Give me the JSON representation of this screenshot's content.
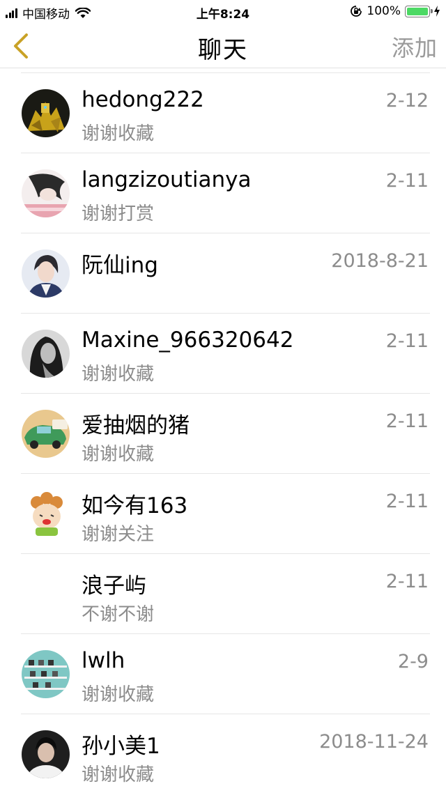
{
  "status_bar": {
    "carrier": "中国移动",
    "time": "上午8:24",
    "battery": "100%",
    "battery_level": 1.0,
    "battery_color": "#4cd964"
  },
  "nav": {
    "back_icon": "chevron-left-icon",
    "back_color": "#c9a227",
    "title": "聊天",
    "add_label": "添加"
  },
  "chats": [
    {
      "name": "hedong222",
      "message": "谢谢收藏",
      "date": "2-12",
      "avatar": "robot-avatar"
    },
    {
      "name": "langzizoutianya",
      "message": "谢谢打赏",
      "date": "2-11",
      "avatar": "girl-sketch-avatar"
    },
    {
      "name": "阮仙ing",
      "message": "",
      "date": "2018-8-21",
      "avatar": "woman-photo-avatar"
    },
    {
      "name": "Maxine_966320642",
      "message": "谢谢收藏",
      "date": "2-11",
      "avatar": "bw-portrait-avatar"
    },
    {
      "name": "爱抽烟的猪",
      "message": "谢谢收藏",
      "date": "2-11",
      "avatar": "toy-car-avatar"
    },
    {
      "name": "如今有163",
      "message": "谢谢关注",
      "date": "2-11",
      "avatar": "cartoon-avatar"
    },
    {
      "name": "浪子屿",
      "message": "不谢不谢",
      "date": "2-11",
      "avatar": "empty-avatar"
    },
    {
      "name": "lwlh",
      "message": "谢谢收藏",
      "date": "2-9",
      "avatar": "shelf-avatar"
    },
    {
      "name": "孙小美1",
      "message": "谢谢收藏",
      "date": "2018-11-24",
      "avatar": "man-photo-avatar"
    }
  ]
}
